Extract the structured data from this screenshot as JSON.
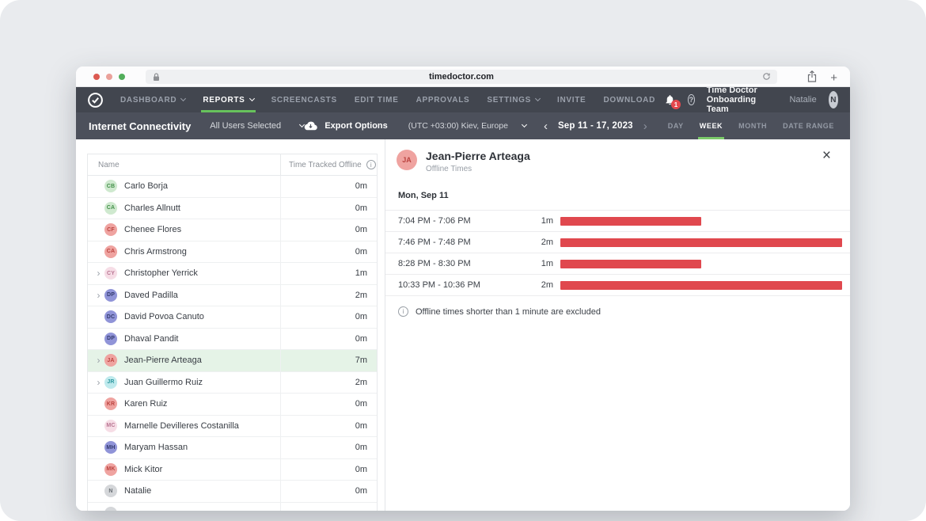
{
  "browser": {
    "url": "timedoctor.com"
  },
  "nav": {
    "items": [
      {
        "label": "DASHBOARD",
        "dropdown": true
      },
      {
        "label": "REPORTS",
        "dropdown": true,
        "active": true
      },
      {
        "label": "SCREENCASTS"
      },
      {
        "label": "EDIT TIME"
      },
      {
        "label": "APPROVALS"
      },
      {
        "label": "SETTINGS",
        "dropdown": true
      },
      {
        "label": "INVITE"
      },
      {
        "label": "DOWNLOAD"
      }
    ],
    "notification_count": "1",
    "team_name": "Time Doctor Onboarding Team",
    "user_name": "Natalie",
    "user_initial": "N"
  },
  "toolbar": {
    "title": "Internet Connectivity",
    "users_filter": "All Users Selected",
    "export_label": "Export Options",
    "timezone": "(UTC +03:00) Kiev, Europe",
    "prev_arrow": "‹",
    "next_arrow": "›",
    "date_range": "Sep 11 - 17, 2023",
    "tabs": [
      {
        "label": "DAY"
      },
      {
        "label": "WEEK",
        "active": true
      },
      {
        "label": "MONTH"
      },
      {
        "label": "DATE RANGE"
      }
    ]
  },
  "table": {
    "col_name": "Name",
    "col_time": "Time Tracked Offline",
    "rows": [
      {
        "name": "Carlo Borja",
        "initials": "CB",
        "color": "green",
        "value": "0m",
        "expandable": false
      },
      {
        "name": "Charles Allnutt",
        "initials": "CA",
        "color": "green",
        "value": "0m",
        "expandable": false
      },
      {
        "name": "Chenee Flores",
        "initials": "CF",
        "color": "red",
        "value": "0m",
        "expandable": false
      },
      {
        "name": "Chris Armstrong",
        "initials": "CA",
        "color": "red",
        "value": "0m",
        "expandable": false
      },
      {
        "name": "Christopher Yerrick",
        "initials": "CY",
        "color": "pink",
        "value": "1m",
        "expandable": true
      },
      {
        "name": "Daved Padilla",
        "initials": "DP",
        "color": "purple",
        "value": "2m",
        "expandable": true
      },
      {
        "name": "David Povoa Canuto",
        "initials": "DC",
        "color": "purple",
        "value": "0m",
        "expandable": false
      },
      {
        "name": "Dhaval Pandit",
        "initials": "DP",
        "color": "purple",
        "value": "0m",
        "expandable": false
      },
      {
        "name": "Jean-Pierre Arteaga",
        "initials": "JA",
        "color": "red",
        "value": "7m",
        "expandable": true,
        "selected": true
      },
      {
        "name": "Juan Guillermo Ruiz",
        "initials": "JR",
        "color": "cyan",
        "value": "2m",
        "expandable": true
      },
      {
        "name": "Karen Ruiz",
        "initials": "KR",
        "color": "red",
        "value": "0m",
        "expandable": false
      },
      {
        "name": "Marnelle Devilleres Costanilla",
        "initials": "MC",
        "color": "pink",
        "value": "0m",
        "expandable": false
      },
      {
        "name": "Maryam Hassan",
        "initials": "MH",
        "color": "purple",
        "value": "0m",
        "expandable": false
      },
      {
        "name": "Mick Kitor",
        "initials": "MK",
        "color": "red",
        "value": "0m",
        "expandable": false
      },
      {
        "name": "Natalie",
        "initials": "N",
        "color": "gray",
        "value": "0m",
        "expandable": false
      },
      {
        "name": "",
        "initials": "",
        "color": "gray",
        "value": "",
        "expandable": false,
        "partial": true
      }
    ]
  },
  "detail": {
    "initials": "JA",
    "avatar_color": "red",
    "name": "Jean-Pierre Arteaga",
    "subtitle": "Offline Times",
    "close_glyph": "×",
    "day_label": "Mon, Sep 11",
    "entries": [
      {
        "range": "7:04 PM - 7:06 PM",
        "duration": "1m",
        "bar_pct": 50
      },
      {
        "range": "7:46 PM - 7:48 PM",
        "duration": "2m",
        "bar_pct": 100
      },
      {
        "range": "8:28 PM - 8:30 PM",
        "duration": "1m",
        "bar_pct": 50
      },
      {
        "range": "10:33 PM - 10:36 PM",
        "duration": "2m",
        "bar_pct": 100
      }
    ],
    "note": "Offline times shorter than 1 minute are excluded"
  },
  "colors": {
    "accent_green": "#67c25c",
    "bar_red": "#e0484e",
    "nav_bg": "#42464f",
    "subnav_bg": "#4c505b",
    "badge_red": "#e5484d",
    "selected_row_bg": "#e5f3e7",
    "avatar_palette": {
      "green": {
        "bg": "#cfe9cf",
        "fg": "#44904a"
      },
      "red": {
        "bg": "#efa3a0",
        "fg": "#bb4440"
      },
      "pink": {
        "bg": "#f6dde6",
        "fg": "#b97693"
      },
      "purple": {
        "bg": "#9094d8",
        "fg": "#333a6e"
      },
      "cyan": {
        "bg": "#bfeaed",
        "fg": "#2e98a0"
      },
      "gray": {
        "bg": "#d5d7da",
        "fg": "#696e74"
      }
    }
  }
}
